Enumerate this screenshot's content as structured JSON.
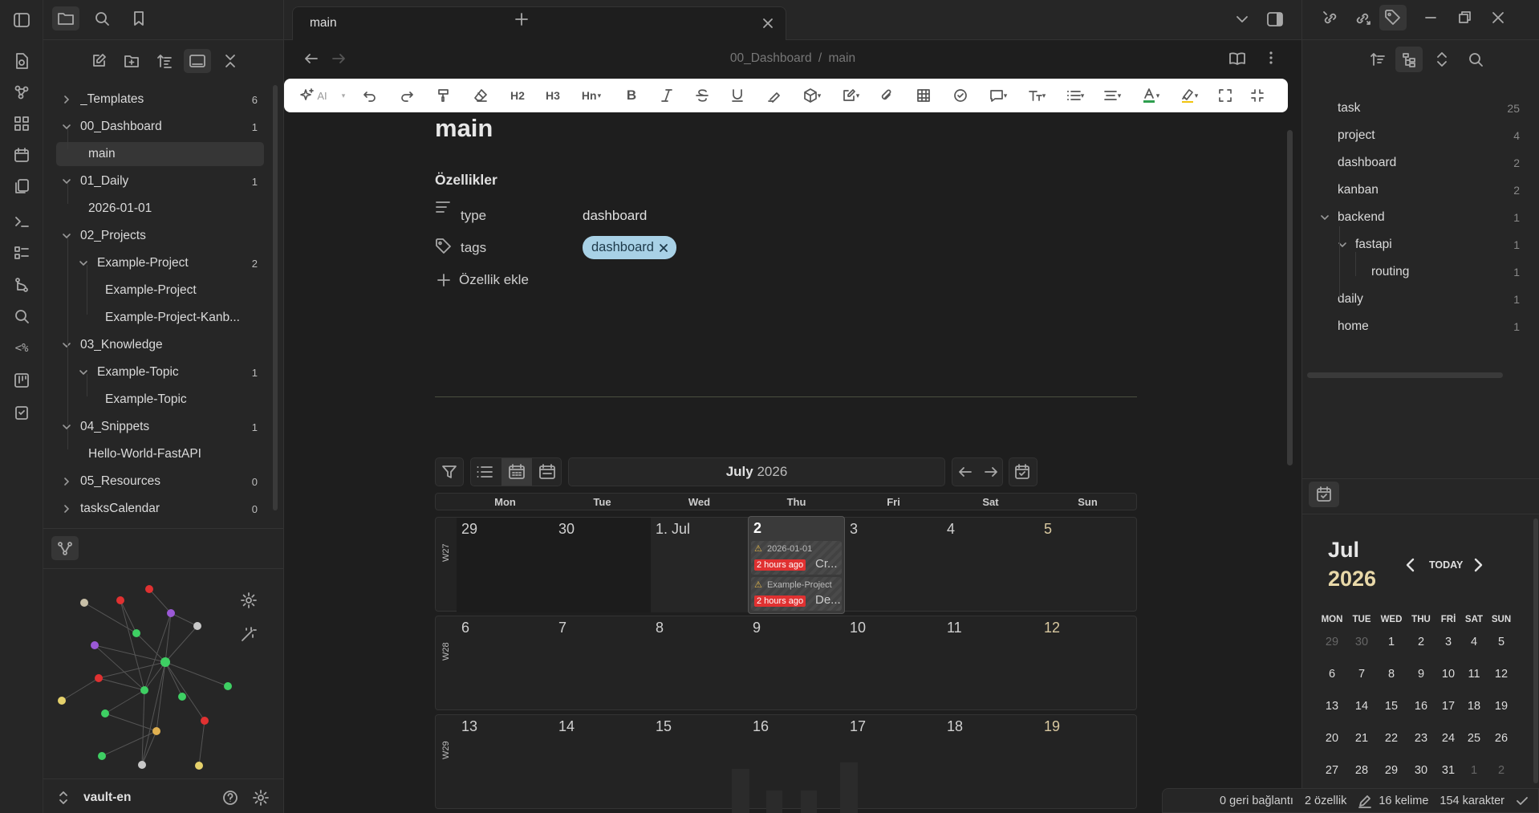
{
  "leftSidebar": {
    "tree": [
      {
        "label": "_Templates",
        "count": "6",
        "expanded": false
      },
      {
        "label": "00_Dashboard",
        "count": "1",
        "expanded": true
      },
      {
        "label": "main",
        "count": "",
        "selected": true
      },
      {
        "label": "01_Daily",
        "count": "1",
        "expanded": true
      },
      {
        "label": "2026-01-01",
        "count": ""
      },
      {
        "label": "02_Projects",
        "count": "",
        "expanded": true
      },
      {
        "label": "Example-Project",
        "count": "2",
        "expanded": true
      },
      {
        "label": "Example-Project",
        "count": ""
      },
      {
        "label": "Example-Project-Kanb...",
        "count": ""
      },
      {
        "label": "03_Knowledge",
        "count": "",
        "expanded": true
      },
      {
        "label": "Example-Topic",
        "count": "1",
        "expanded": true
      },
      {
        "label": "Example-Topic",
        "count": ""
      },
      {
        "label": "04_Snippets",
        "count": "1",
        "expanded": true
      },
      {
        "label": "Hello-World-FastAPI",
        "count": ""
      },
      {
        "label": "05_Resources",
        "count": "0",
        "expanded": false
      },
      {
        "label": "tasksCalendar",
        "count": "0",
        "expanded": false
      }
    ],
    "vault_name": "vault-en"
  },
  "tab": {
    "title": "main"
  },
  "breadcrumb": {
    "folder": "00_Dashboard",
    "sep": "/",
    "file": "main"
  },
  "toolbar": {
    "ai_label": "AI",
    "h2": "H2",
    "h3": "H3",
    "hn": "Hn"
  },
  "note": {
    "title": "main",
    "properties_heading": "Özellikler",
    "props": [
      {
        "key": "type",
        "value": "dashboard"
      },
      {
        "key": "tags",
        "value": "dashboard"
      }
    ],
    "add_property": "Özellik ekle"
  },
  "calendar": {
    "month": "July",
    "year": "2026",
    "weekdays": [
      "Mon",
      "Tue",
      "Wed",
      "Thu",
      "Fri",
      "Sat",
      "Sun"
    ],
    "weeks": [
      {
        "label": "W27",
        "days": [
          "29",
          "30",
          "1. Jul",
          "2",
          "3",
          "4",
          "5"
        ]
      },
      {
        "label": "W28",
        "days": [
          "6",
          "7",
          "8",
          "9",
          "10",
          "11",
          "12"
        ]
      },
      {
        "label": "W29",
        "days": [
          "13",
          "14",
          "15",
          "16",
          "17",
          "18",
          "19"
        ]
      }
    ],
    "events": [
      {
        "file": "2026-01-01",
        "ago": "2 hours ago",
        "text": "Cr..."
      },
      {
        "file": "Example-Project",
        "ago": "2 hours ago",
        "text": "De..."
      }
    ]
  },
  "tags": [
    {
      "label": "task",
      "count": "25"
    },
    {
      "label": "project",
      "count": "4"
    },
    {
      "label": "dashboard",
      "count": "2"
    },
    {
      "label": "kanban",
      "count": "2"
    },
    {
      "label": "backend",
      "count": "1"
    },
    {
      "label": "fastapi",
      "count": "1"
    },
    {
      "label": "routing",
      "count": "1"
    },
    {
      "label": "daily",
      "count": "1"
    },
    {
      "label": "home",
      "count": "1"
    }
  ],
  "miniCalendar": {
    "month": "Jul",
    "year": "2026",
    "today_label": "TODAY",
    "dow": [
      "MON",
      "TUE",
      "WED",
      "THU",
      "FRİ",
      "SAT",
      "SUN"
    ],
    "rows": [
      [
        "29",
        "30",
        "1",
        "2",
        "3",
        "4",
        "5"
      ],
      [
        "6",
        "7",
        "8",
        "9",
        "10",
        "11",
        "12"
      ],
      [
        "13",
        "14",
        "15",
        "16",
        "17",
        "18",
        "19"
      ],
      [
        "20",
        "21",
        "22",
        "23",
        "24",
        "25",
        "26"
      ],
      [
        "27",
        "28",
        "29",
        "30",
        "31",
        "1",
        "2"
      ]
    ]
  },
  "statusbar": {
    "backlinks": "0 geri bağlantı",
    "properties": "2 özellik",
    "words": "16 kelime",
    "chars": "154 karakter"
  },
  "colors": {
    "accent_red": "#e03131",
    "tag_pill": "#a8d1e6",
    "graph_green": "#3ecf63",
    "graph_purple": "#9b59d6",
    "graph_yellow": "#e5d16b"
  }
}
